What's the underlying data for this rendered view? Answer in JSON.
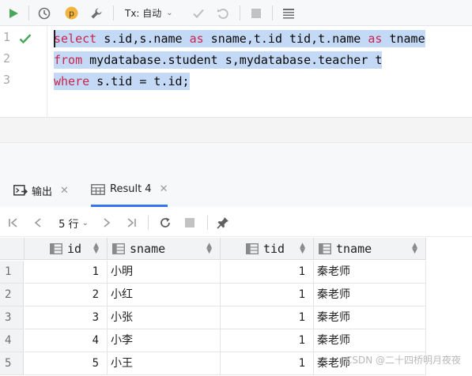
{
  "toolbar": {
    "tx_label": "Tx: 自动",
    "buttons": [
      "run",
      "history",
      "profile",
      "settings",
      "tx-mode",
      "commit",
      "rollback",
      "stop",
      "table-view"
    ]
  },
  "editor": {
    "line_numbers": [
      "1",
      "2",
      "3"
    ],
    "lines": [
      [
        {
          "t": "select",
          "kw": true
        },
        {
          "t": " s.id,s.name ",
          "kw": false
        },
        {
          "t": "as",
          "kw": true
        },
        {
          "t": " sname,t.id tid,t.name ",
          "kw": false
        },
        {
          "t": "as",
          "kw": true
        },
        {
          "t": " tname",
          "kw": false
        }
      ],
      [
        {
          "t": "from",
          "kw": true
        },
        {
          "t": " mydatabase.student s,mydatabase.teacher t",
          "kw": false
        }
      ],
      [
        {
          "t": "where",
          "kw": true
        },
        {
          "t": " s.tid = t.id;",
          "kw": false
        }
      ]
    ]
  },
  "tabs": {
    "output": {
      "label": "输出"
    },
    "result": {
      "label": "Result 4"
    }
  },
  "results_toolbar": {
    "page_size": "5 行"
  },
  "grid": {
    "columns": [
      "id",
      "sname",
      "tid",
      "tname"
    ],
    "row_numbers": [
      "1",
      "2",
      "3",
      "4",
      "5"
    ],
    "rows": [
      [
        "1",
        "小明",
        "1",
        "秦老师"
      ],
      [
        "2",
        "小红",
        "1",
        "秦老师"
      ],
      [
        "3",
        "小张",
        "1",
        "秦老师"
      ],
      [
        "4",
        "小李",
        "1",
        "秦老师"
      ],
      [
        "5",
        "小王",
        "1",
        "秦老师"
      ]
    ]
  },
  "watermark": "CSDN @二十四桥明月夜夜",
  "colors": {
    "accent": "#3574f0",
    "keyword": "#c7254e",
    "selection": "#c4d9f5",
    "run_green": "#4aa65a",
    "profile_orange": "#f2b441"
  }
}
